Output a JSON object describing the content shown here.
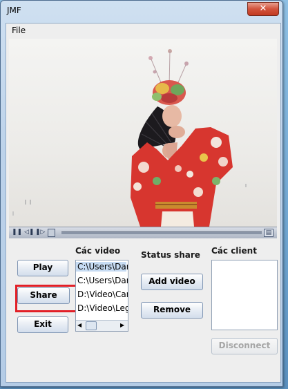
{
  "window": {
    "title": "JMF",
    "close_glyph": "✕"
  },
  "menu": {
    "file": "File"
  },
  "player": {
    "video_description": "video frame",
    "controls": {
      "pause_icon": "pause-icon",
      "rewind_icon": "step-back-icon",
      "forward_icon": "step-forward-icon",
      "progress": 0.0
    }
  },
  "buttons": {
    "play": "Play",
    "share": "Share",
    "exit": "Exit",
    "add_video": "Add video",
    "remove": "Remove",
    "disconnect": "Disconnect"
  },
  "labels": {
    "videos": "Các video",
    "status_share": "Status share",
    "clients": "Các client"
  },
  "video_list": [
    {
      "text": "C:\\Users\\Dan",
      "selected": true
    },
    {
      "text": "C:\\Users\\Dan",
      "selected": false
    },
    {
      "text": "D:\\Video\\Cant",
      "selected": false
    },
    {
      "text": "D:\\Video\\Lege",
      "selected": false
    }
  ],
  "client_list": [],
  "colors": {
    "highlight_border": "#e21f26",
    "close_button": "#c23a22",
    "selected_item": "#c7dcf3"
  }
}
